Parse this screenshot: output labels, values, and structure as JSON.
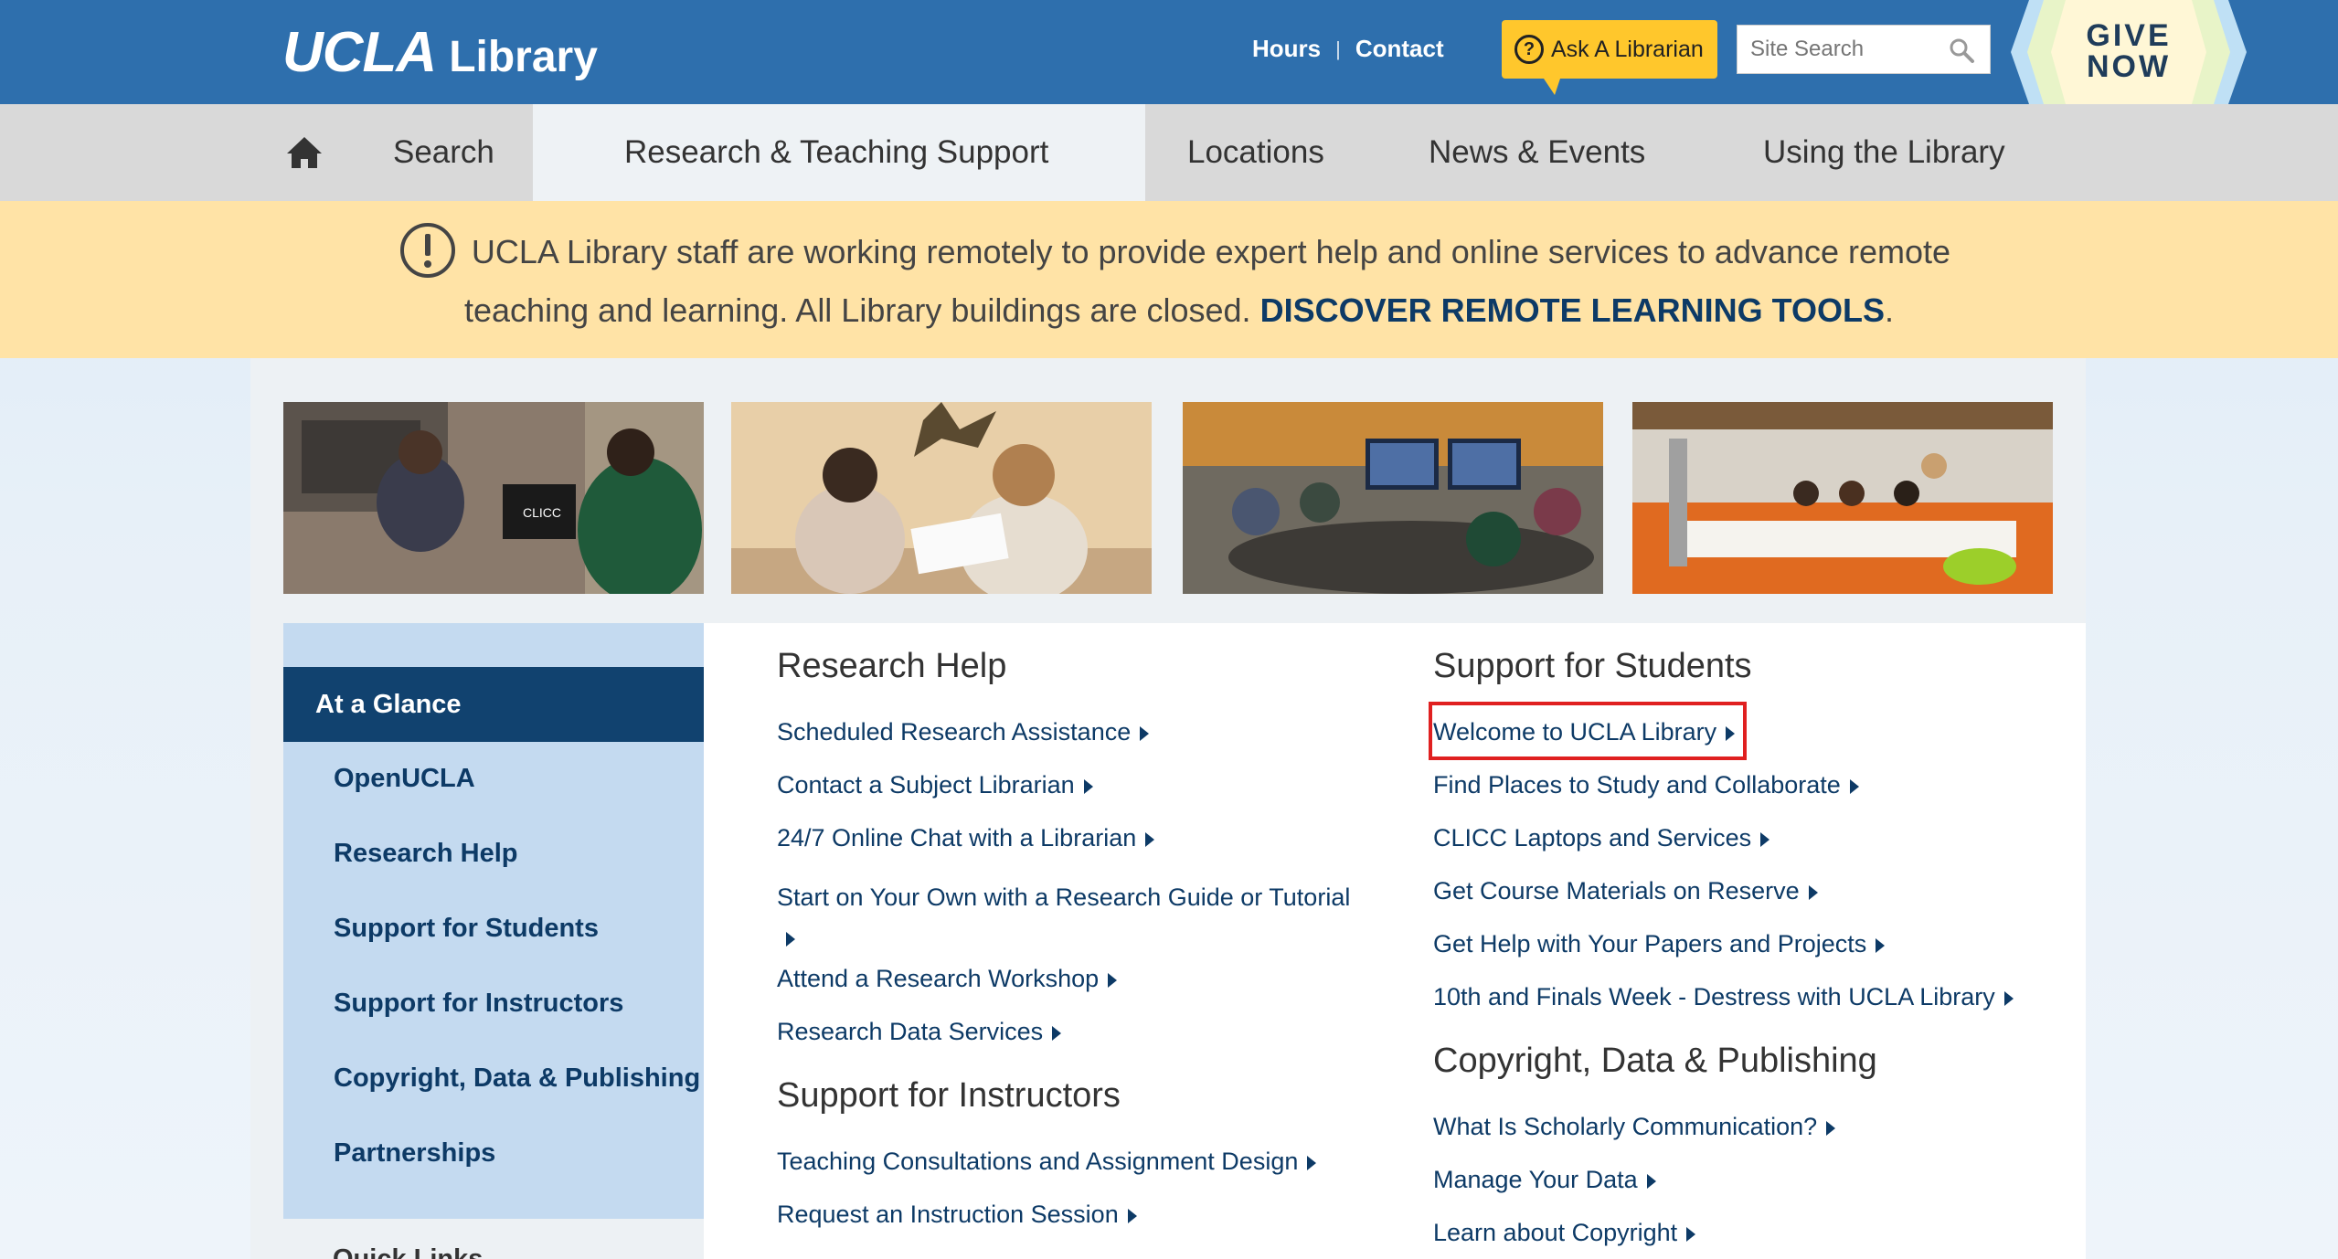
{
  "header": {
    "logo_ucla": "UCLA",
    "logo_library": "Library",
    "hours": "Hours",
    "separator": "|",
    "contact": "Contact",
    "ask_librarian": "Ask A Librarian",
    "search_placeholder": "Site Search",
    "give_line1": "GIVE",
    "give_line2": "NOW"
  },
  "nav": {
    "items": [
      {
        "label": "Search"
      },
      {
        "label": "Research & Teaching Support"
      },
      {
        "label": "Locations"
      },
      {
        "label": "News & Events"
      },
      {
        "label": "Using the Library"
      }
    ]
  },
  "alert": {
    "text": "UCLA Library staff are working remotely to provide expert help and online services to advance remote teaching and learning. All Library buildings are closed.",
    "cta": "DISCOVER REMOTE LEARNING TOOLS",
    "tail": "."
  },
  "sidebar": {
    "heading": "At a Glance",
    "items": [
      {
        "label": "OpenUCLA"
      },
      {
        "label": "Research Help"
      },
      {
        "label": "Support for Students"
      },
      {
        "label": "Support for Instructors"
      },
      {
        "label": "Copyright, Data & Publishing"
      },
      {
        "label": "Partnerships"
      }
    ],
    "quick_links": "Quick Links"
  },
  "research_help": {
    "title": "Research Help",
    "links": [
      {
        "label": "Scheduled Research Assistance"
      },
      {
        "label": "Contact a Subject Librarian"
      },
      {
        "label": "24/7 Online Chat with a Librarian"
      },
      {
        "label": "Start on Your Own with a Research Guide or Tutorial"
      },
      {
        "label": "Attend a Research Workshop"
      },
      {
        "label": "Research Data Services"
      }
    ]
  },
  "support_instructors": {
    "title": "Support for Instructors",
    "links": [
      {
        "label": "Teaching Consultations and Assignment Design"
      },
      {
        "label": "Request an Instruction Session"
      }
    ]
  },
  "support_students": {
    "title": "Support for Students",
    "links": [
      {
        "label": "Welcome to UCLA Library"
      },
      {
        "label": "Find Places to Study and Collaborate"
      },
      {
        "label": "CLICC Laptops and Services"
      },
      {
        "label": "Get Course Materials on Reserve"
      },
      {
        "label": "Get Help with Your Papers and Projects"
      },
      {
        "label": "10th and Finals Week - Destress with UCLA Library"
      }
    ]
  },
  "copyright": {
    "title": "Copyright, Data & Publishing",
    "links": [
      {
        "label": "What Is Scholarly Communication?"
      },
      {
        "label": "Manage Your Data"
      },
      {
        "label": "Learn about Copyright"
      }
    ]
  },
  "photo_shirt_text": "CLICC",
  "colors": {
    "brand_blue": "#2e6fad",
    "dark_blue": "#11426f",
    "link_blue": "#0d3a66",
    "gold": "#ffc72c",
    "alert_bg": "#ffe3a6",
    "highlight_red": "#e02020"
  }
}
